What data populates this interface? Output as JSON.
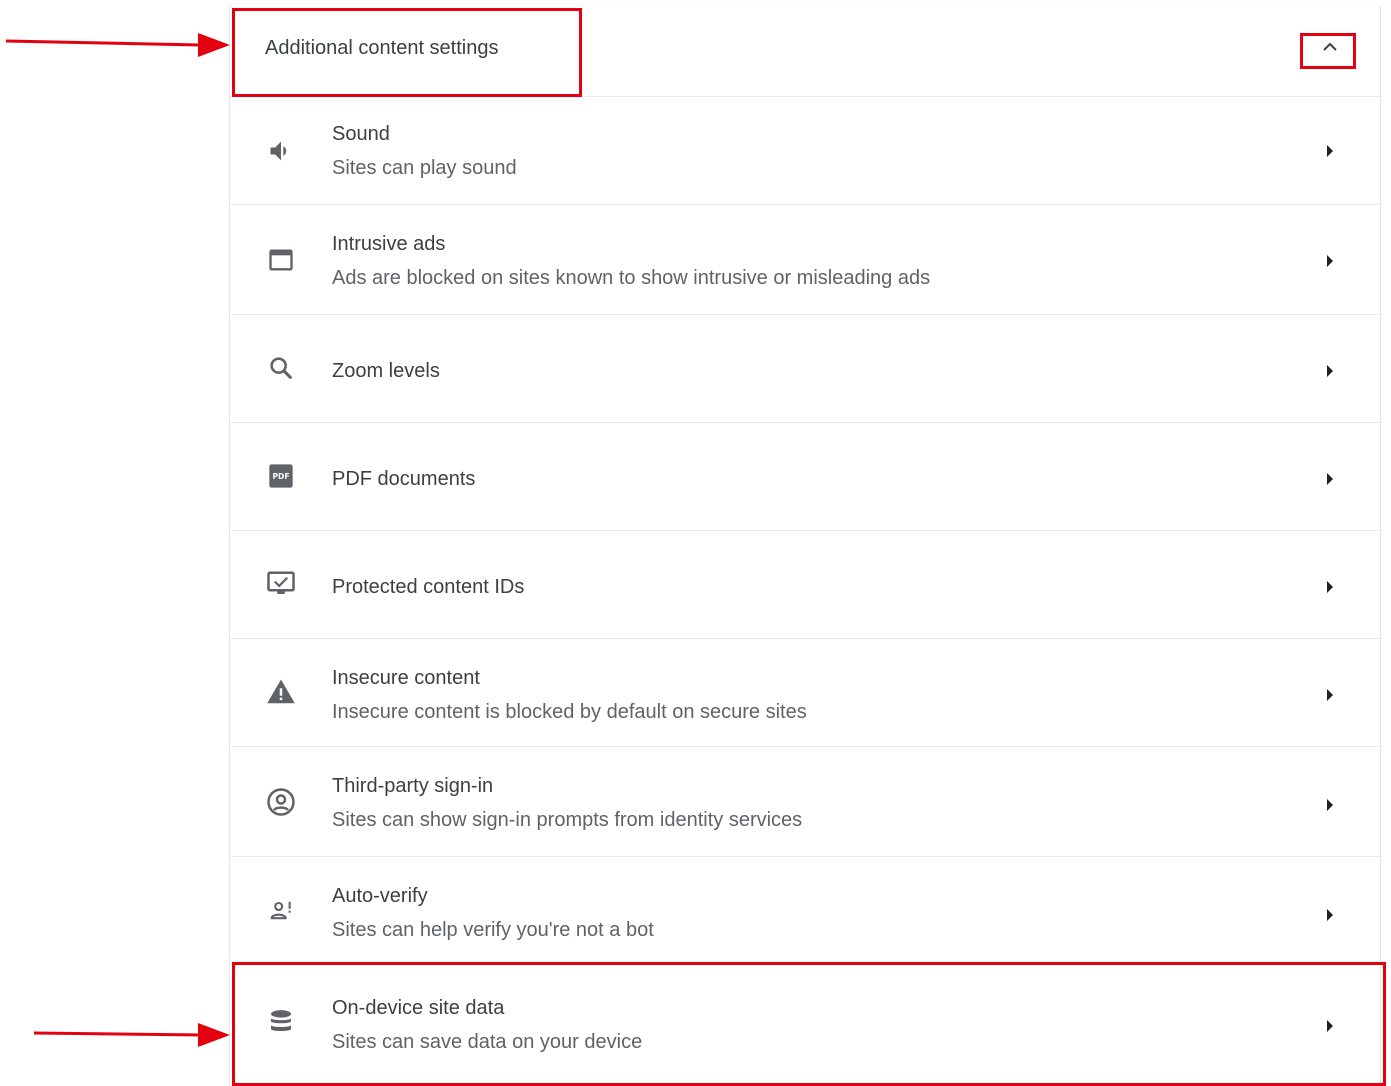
{
  "section": {
    "title": "Additional content settings",
    "collapse_icon": "chevron-up-icon"
  },
  "rows": [
    {
      "key": "sound",
      "label": "Sound",
      "sublabel": "Sites can play sound",
      "icon": "speaker-icon"
    },
    {
      "key": "intrusive-ads",
      "label": "Intrusive ads",
      "sublabel": "Ads are blocked on sites known to show intrusive or misleading ads",
      "icon": "window-icon"
    },
    {
      "key": "zoom-levels",
      "label": "Zoom levels",
      "sublabel": "",
      "icon": "magnifier-icon"
    },
    {
      "key": "pdf-documents",
      "label": "PDF documents",
      "sublabel": "",
      "icon": "pdf-icon"
    },
    {
      "key": "protected-content",
      "label": "Protected content IDs",
      "sublabel": "",
      "icon": "monitor-check-icon"
    },
    {
      "key": "insecure-content",
      "label": "Insecure content",
      "sublabel": "Insecure content is blocked by default on secure sites",
      "icon": "warning-icon"
    },
    {
      "key": "third-party-sign-in",
      "label": "Third-party sign-in",
      "sublabel": "Sites can show sign-in prompts from identity services",
      "icon": "account-circle-icon"
    },
    {
      "key": "auto-verify",
      "label": "Auto-verify",
      "sublabel": "Sites can help verify you're not a bot",
      "icon": "person-alert-icon"
    },
    {
      "key": "on-device-site-data",
      "label": "On-device site data",
      "sublabel": "Sites can save data on your device",
      "icon": "database-icon"
    }
  ],
  "colors": {
    "highlight": "#e3000f",
    "icon": "#5f6368",
    "text_primary": "#3c4043",
    "text_secondary": "#5f6368"
  }
}
